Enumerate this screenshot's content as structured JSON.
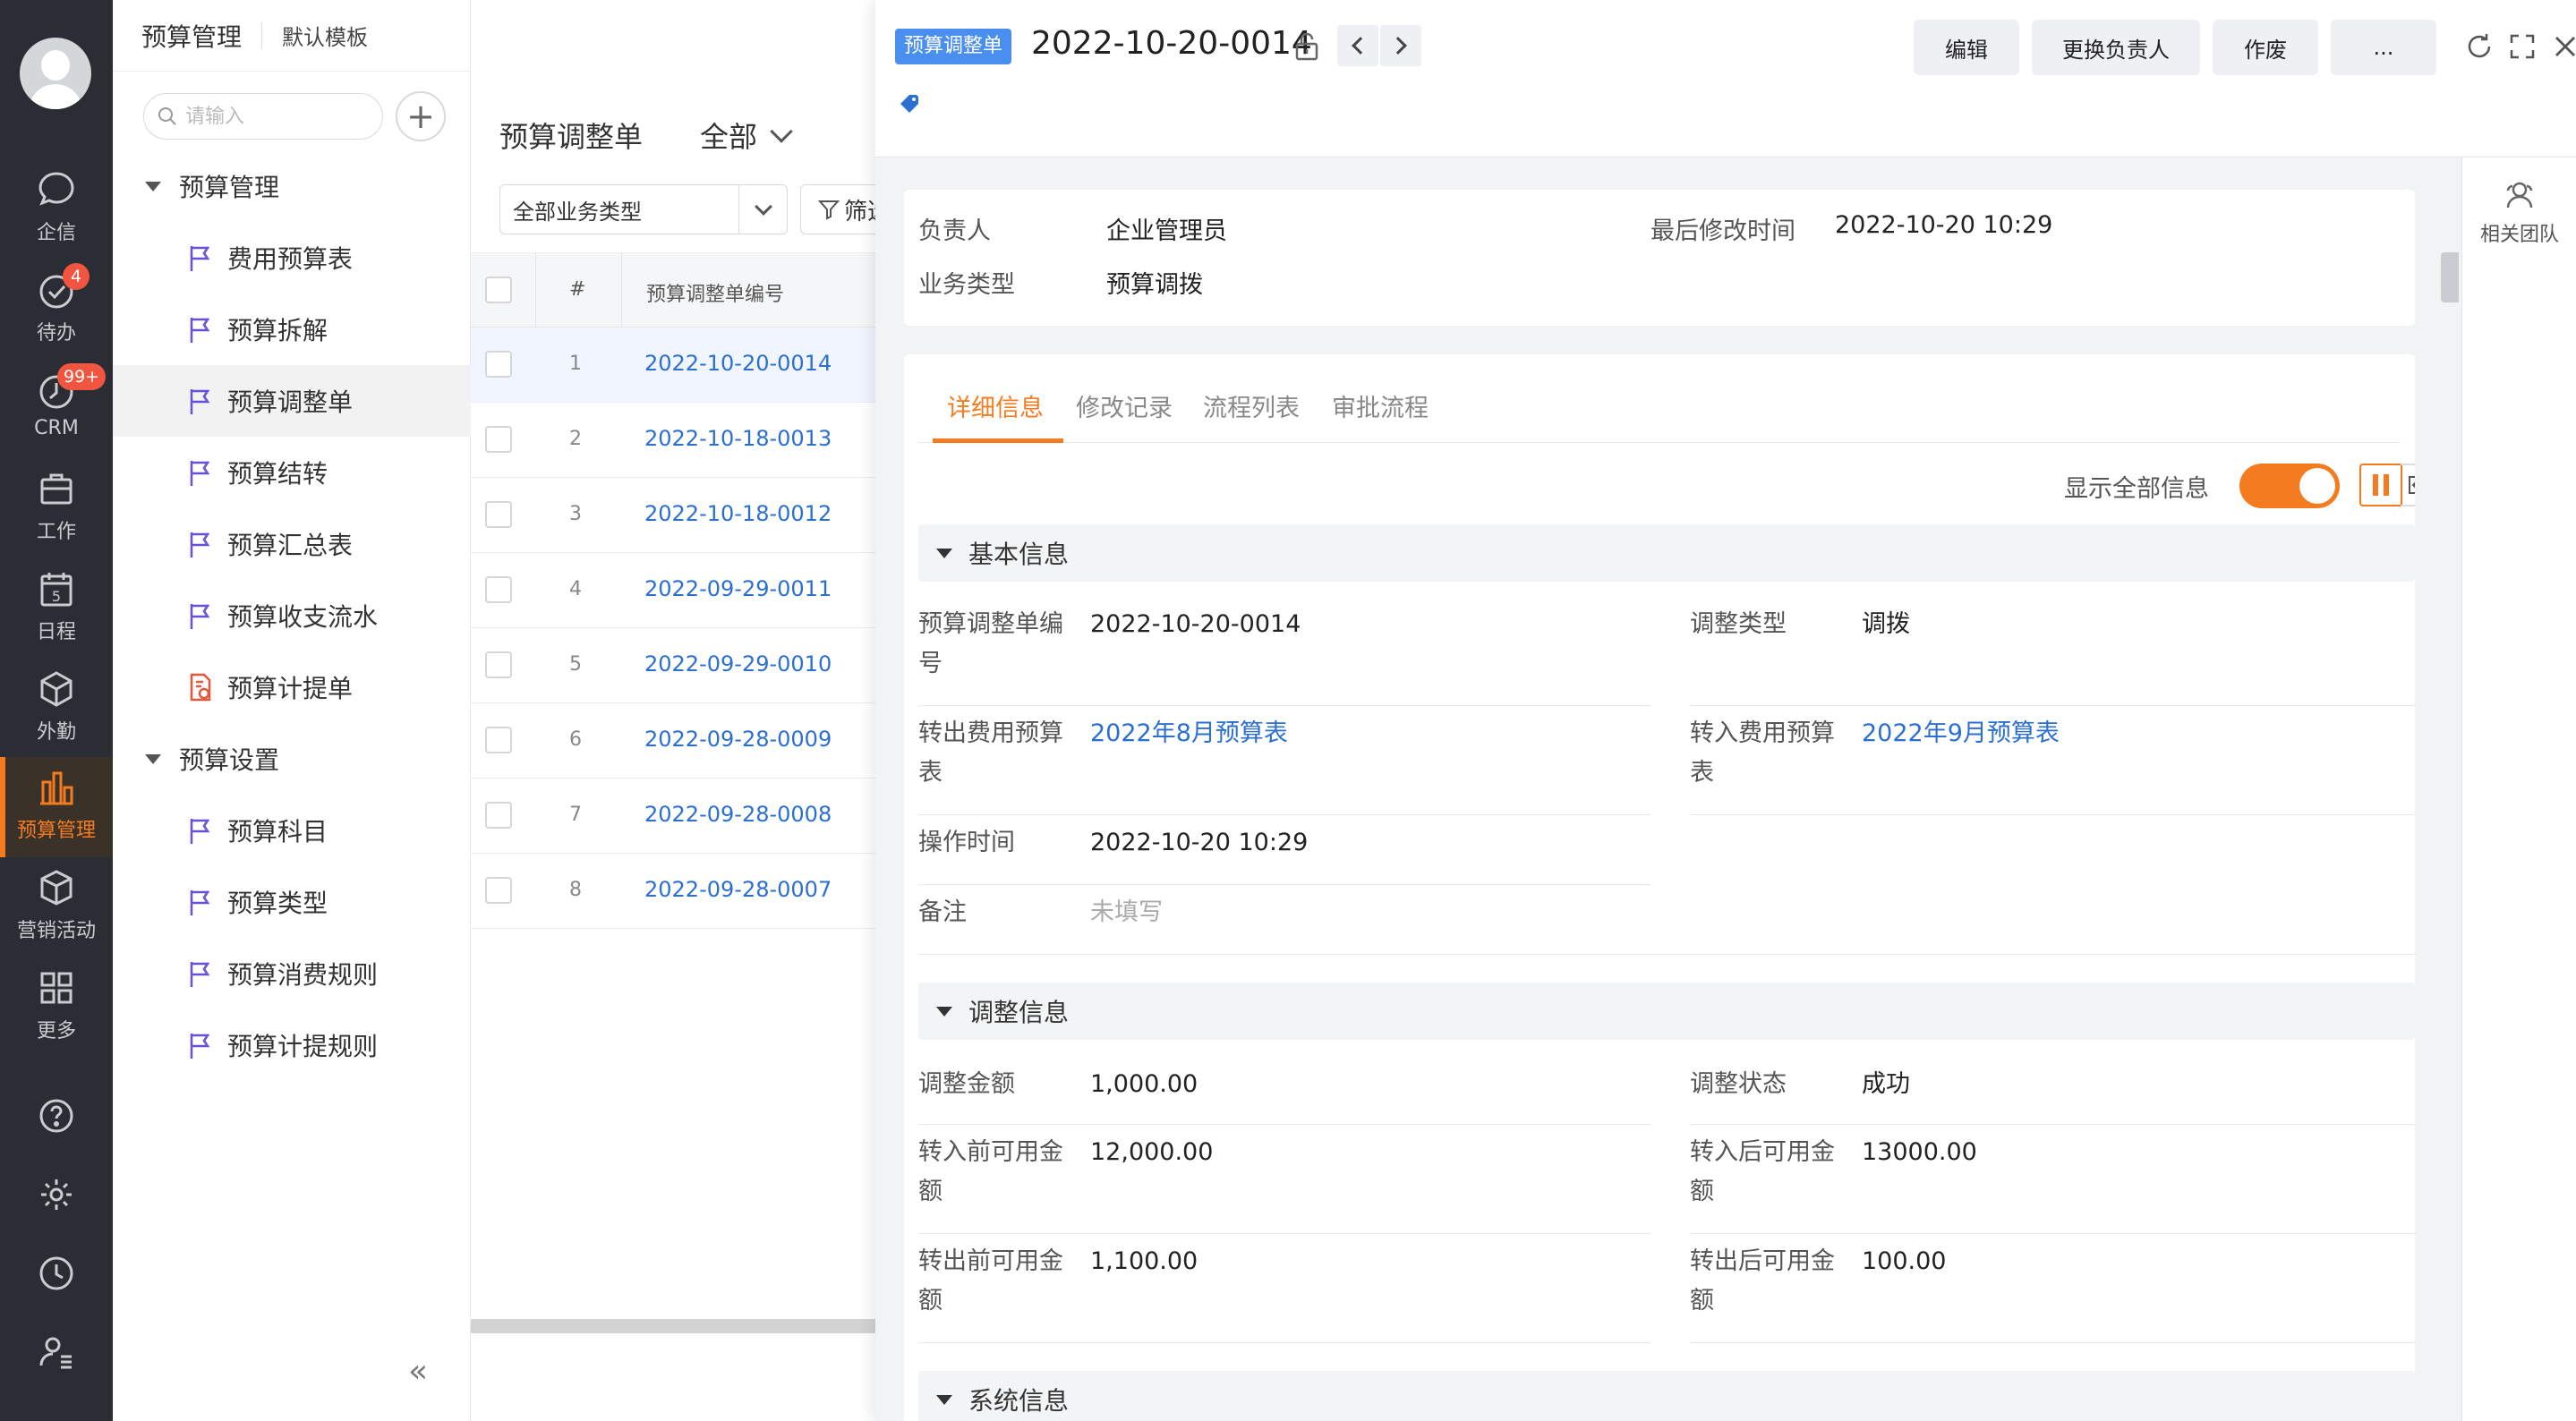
{
  "rail": {
    "items": [
      {
        "label": "企信",
        "icon": "chat-icon"
      },
      {
        "label": "待办",
        "icon": "check-circle-icon",
        "badge": "4"
      },
      {
        "label": "CRM",
        "icon": "clock-icon",
        "badge": "99+"
      },
      {
        "label": "工作",
        "icon": "briefcase-icon"
      },
      {
        "label": "日程",
        "icon": "calendar-icon",
        "calendar_day": "5"
      },
      {
        "label": "外勤",
        "icon": "cube-icon"
      },
      {
        "label": "预算管理",
        "icon": "bar-chart-icon",
        "active": true
      },
      {
        "label": "营销活动",
        "icon": "box-icon"
      },
      {
        "label": "更多",
        "icon": "grid-icon"
      }
    ],
    "bottom_icons": [
      "help-icon",
      "settings-icon",
      "history-icon",
      "user-settings-icon"
    ]
  },
  "menu": {
    "app_title": "预算管理",
    "template": "默认模板",
    "search_placeholder": "请输入",
    "groups": [
      {
        "label": "预算管理",
        "items": [
          "费用预算表",
          "预算拆解",
          "预算调整单",
          "预算结转",
          "预算汇总表",
          "预算收支流水",
          "预算计提单"
        ]
      },
      {
        "label": "预算设置",
        "items": [
          "预算科目",
          "预算类型",
          "预算消费规则",
          "预算计提规则"
        ]
      }
    ],
    "active_item": "预算调整单"
  },
  "list": {
    "title": "预算调整单",
    "scope": "全部",
    "type_select": "全部业务类型",
    "filter_label": "筛选",
    "columns": [
      "#",
      "预算调整单编号"
    ],
    "rows": [
      {
        "n": "1",
        "code": "2022-10-20-0014"
      },
      {
        "n": "2",
        "code": "2022-10-18-0013"
      },
      {
        "n": "3",
        "code": "2022-10-18-0012"
      },
      {
        "n": "4",
        "code": "2022-09-29-0011"
      },
      {
        "n": "5",
        "code": "2022-09-29-0010"
      },
      {
        "n": "6",
        "code": "2022-09-28-0009"
      },
      {
        "n": "7",
        "code": "2022-09-28-0008"
      },
      {
        "n": "8",
        "code": "2022-09-28-0007"
      }
    ]
  },
  "detail": {
    "tag": "预算调整单",
    "title": "2022-10-20-0014",
    "buttons": [
      "编辑",
      "更换负责人",
      "作废",
      "..."
    ],
    "summary": {
      "owner_label": "负责人",
      "owner": "企业管理员",
      "modified_label": "最后修改时间",
      "modified": "2022-10-20 10:29",
      "biztype_label": "业务类型",
      "biztype": "预算调拨"
    },
    "tabs": [
      "详细信息",
      "修改记录",
      "流程列表",
      "审批流程"
    ],
    "show_all_label": "显示全部信息",
    "show_all_on": true,
    "side_label": "相关团队",
    "sections": {
      "basic": {
        "title": "基本信息",
        "code_label": "预算调整单编号",
        "code": "2022-10-20-0014",
        "adj_type_label": "调整类型",
        "adj_type": "调拨",
        "out_budget_label": "转出费用预算表",
        "out_budget": "2022年8月预算表",
        "in_budget_label": "转入费用预算表",
        "in_budget": "2022年9月预算表",
        "op_time_label": "操作时间",
        "op_time": "2022-10-20 10:29",
        "note_label": "备注",
        "note": "未填写"
      },
      "adjust": {
        "title": "调整信息",
        "amount_label": "调整金额",
        "amount": "1,000.00",
        "status_label": "调整状态",
        "status": "成功",
        "in_before_label": "转入前可用金额",
        "in_before": "12,000.00",
        "in_after_label": "转入后可用金额",
        "in_after": "13000.00",
        "out_before_label": "转出前可用金额",
        "out_before": "1,100.00",
        "out_after_label": "转出后可用金额",
        "out_after": "100.00"
      },
      "system": {
        "title": "系统信息"
      }
    }
  },
  "colors": {
    "accent": "#f47b20",
    "link": "#2b6fd1",
    "rail_bg": "#2a2d33",
    "tag_bg": "#4a8ff0"
  }
}
